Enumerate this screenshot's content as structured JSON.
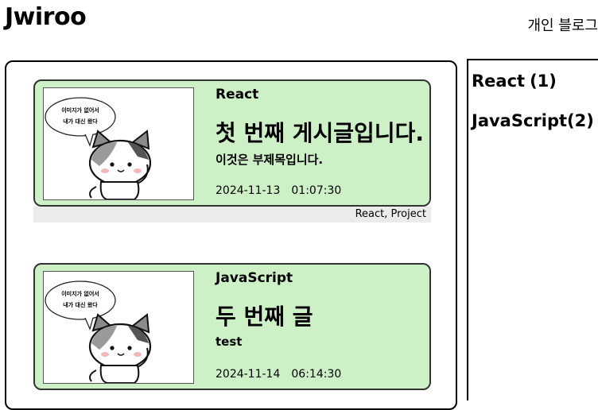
{
  "header": {
    "logo": "Jwiroo",
    "blog_link": "개인 블로그"
  },
  "posts": [
    {
      "thumb_text_1": "이미지가 없어서",
      "thumb_text_2": "내가 대신 왔다",
      "category": "React",
      "title": "첫 번째 게시글입니다.",
      "subtitle": "이것은 부제목입니다.",
      "date": "2024-11-13",
      "time": "01:07:30",
      "tags": "React, Project"
    },
    {
      "thumb_text_1": "이미지가 없어서",
      "thumb_text_2": "내가 대신 왔다",
      "category": "JavaScript",
      "title": "두 번째 글",
      "subtitle": "test",
      "date": "2024-11-14",
      "time": "06:14:30",
      "tags": ""
    }
  ],
  "sidebar": {
    "categories": [
      {
        "name": "React",
        "count": "(1)"
      },
      {
        "name": "JavaScript",
        "count": "(2)"
      }
    ]
  }
}
